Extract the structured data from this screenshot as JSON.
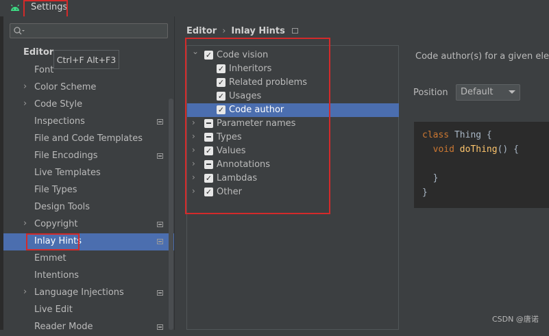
{
  "window": {
    "title": "Settings",
    "tooltip": "Ctrl+F Alt+F3"
  },
  "sidebar": {
    "section_heading": "Editor",
    "items": [
      {
        "label": "Font",
        "chevron": false,
        "badge": false
      },
      {
        "label": "Color Scheme",
        "chevron": true,
        "badge": false
      },
      {
        "label": "Code Style",
        "chevron": true,
        "badge": false
      },
      {
        "label": "Inspections",
        "chevron": false,
        "badge": true
      },
      {
        "label": "File and Code Templates",
        "chevron": false,
        "badge": false
      },
      {
        "label": "File Encodings",
        "chevron": false,
        "badge": true
      },
      {
        "label": "Live Templates",
        "chevron": false,
        "badge": false
      },
      {
        "label": "File Types",
        "chevron": false,
        "badge": false
      },
      {
        "label": "Design Tools",
        "chevron": false,
        "badge": false
      },
      {
        "label": "Copyright",
        "chevron": true,
        "badge": true
      },
      {
        "label": "Inlay Hints",
        "chevron": false,
        "badge": true,
        "selected": true
      },
      {
        "label": "Emmet",
        "chevron": false,
        "badge": false
      },
      {
        "label": "Intentions",
        "chevron": false,
        "badge": false
      },
      {
        "label": "Language Injections",
        "chevron": true,
        "badge": true
      },
      {
        "label": "Live Edit",
        "chevron": false,
        "badge": false
      },
      {
        "label": "Reader Mode",
        "chevron": false,
        "badge": true
      }
    ]
  },
  "breadcrumb": {
    "parent": "Editor",
    "separator": "›",
    "current": "Inlay Hints"
  },
  "tree": {
    "nodes": [
      {
        "label": "Code vision",
        "level": 0,
        "expanded": true,
        "state": "checked"
      },
      {
        "label": "Inheritors",
        "level": 1,
        "state": "checked"
      },
      {
        "label": "Related problems",
        "level": 1,
        "state": "checked"
      },
      {
        "label": "Usages",
        "level": 1,
        "state": "checked"
      },
      {
        "label": "Code author",
        "level": 1,
        "state": "checked",
        "selected": true
      },
      {
        "label": "Parameter names",
        "level": 0,
        "expanded": false,
        "state": "mixed"
      },
      {
        "label": "Types",
        "level": 0,
        "expanded": false,
        "state": "mixed"
      },
      {
        "label": "Values",
        "level": 0,
        "expanded": false,
        "state": "checked"
      },
      {
        "label": "Annotations",
        "level": 0,
        "expanded": false,
        "state": "mixed"
      },
      {
        "label": "Lambdas",
        "level": 0,
        "expanded": false,
        "state": "checked"
      },
      {
        "label": "Other",
        "level": 0,
        "expanded": false,
        "state": "checked"
      }
    ]
  },
  "details": {
    "description": "Code author(s) for a given element",
    "position_label": "Position",
    "position_value": "Default",
    "code_lines": [
      [
        {
          "t": "class ",
          "c": "kw"
        },
        {
          "t": "Thing",
          "c": ""
        },
        {
          "t": " {",
          "c": ""
        }
      ],
      [
        {
          "t": "  void ",
          "c": "kw"
        },
        {
          "t": "doThing",
          "c": "fn"
        },
        {
          "t": "() {",
          "c": ""
        }
      ],
      [],
      [
        {
          "t": "  }",
          "c": ""
        }
      ],
      [
        {
          "t": "}",
          "c": ""
        }
      ]
    ]
  },
  "watermark": "CSDN @唐诺",
  "colors": {
    "selection": "#4b6eaf",
    "highlight_outline": "#d42a2a",
    "keyword": "#cc7832",
    "function": "#ffc66d"
  }
}
